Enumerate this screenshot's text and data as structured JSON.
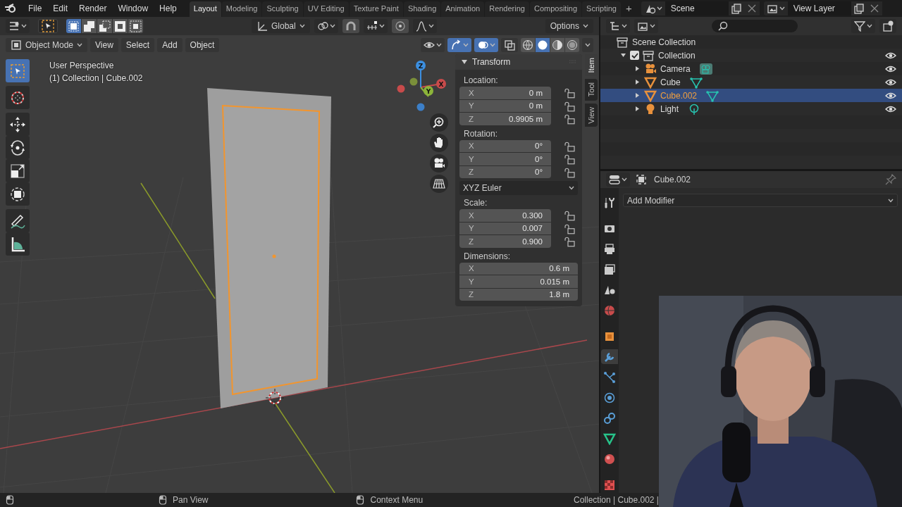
{
  "menu_bar": {
    "menus": [
      "File",
      "Edit",
      "Render",
      "Window",
      "Help"
    ],
    "workspaces": [
      {
        "label": "Layout",
        "selected": true
      },
      {
        "label": "Modeling",
        "selected": false
      },
      {
        "label": "Sculpting",
        "selected": false
      },
      {
        "label": "UV Editing",
        "selected": false
      },
      {
        "label": "Texture Paint",
        "selected": false
      },
      {
        "label": "Shading",
        "selected": false
      },
      {
        "label": "Animation",
        "selected": false
      },
      {
        "label": "Rendering",
        "selected": false
      },
      {
        "label": "Compositing",
        "selected": false
      },
      {
        "label": "Scripting",
        "selected": false
      }
    ],
    "add_workspace": "+",
    "scene": "Scene",
    "view_layer": "View Layer"
  },
  "tool_header": {
    "select_modes": [
      {
        "kind": "new",
        "selected": true
      },
      {
        "kind": "extend",
        "selected": false
      },
      {
        "kind": "subtract",
        "selected": false
      },
      {
        "kind": "difference",
        "selected": false
      },
      {
        "kind": "intersect",
        "selected": false
      }
    ],
    "orientation": "Global",
    "options": "Options"
  },
  "viewport_header": {
    "mode": "Object Mode",
    "menus": [
      "View",
      "Select",
      "Add",
      "Object"
    ],
    "toggles": [
      {
        "kind": "gizmos",
        "on": true
      },
      {
        "kind": "overlays",
        "on": true
      },
      {
        "kind": "xray",
        "on": false
      }
    ],
    "shading": [
      {
        "kind": "wireframe",
        "selected": false
      },
      {
        "kind": "solid",
        "selected": true
      },
      {
        "kind": "material",
        "selected": false
      },
      {
        "kind": "rendered",
        "selected": false
      }
    ]
  },
  "viewport": {
    "overlay_lines": [
      "User Perspective",
      "(1) Collection | Cube.002"
    ],
    "tools": [
      {
        "kind": "select",
        "selected": true
      },
      {
        "kind": "cursor",
        "selected": false
      },
      {
        "kind": "move",
        "selected": false
      },
      {
        "kind": "rotate",
        "selected": false
      },
      {
        "kind": "scale",
        "selected": false
      },
      {
        "kind": "transform",
        "selected": false
      },
      {
        "kind": "annotate",
        "selected": false
      },
      {
        "kind": "measure",
        "selected": false
      }
    ],
    "gizmo_axes": [
      "X",
      "Y",
      "Z"
    ]
  },
  "sidebar": {
    "tabs": [
      {
        "label": "Item",
        "selected": true
      },
      {
        "label": "Tool",
        "selected": false
      },
      {
        "label": "View",
        "selected": false
      }
    ],
    "panel": {
      "title": "Transform",
      "expanded": true,
      "sections": [
        {
          "kind": "vector",
          "label": "Location:",
          "fields": [
            {
              "axis": "X",
              "value": "0 m",
              "locked": false
            },
            {
              "axis": "Y",
              "value": "0 m",
              "locked": false
            },
            {
              "axis": "Z",
              "value": "0.9905 m",
              "locked": false
            }
          ]
        },
        {
          "kind": "vector",
          "label": "Rotation:",
          "fields": [
            {
              "axis": "X",
              "value": "0°",
              "locked": false
            },
            {
              "axis": "Y",
              "value": "0°",
              "locked": false
            },
            {
              "axis": "Z",
              "value": "0°",
              "locked": false
            }
          ]
        },
        {
          "kind": "dropdown",
          "value": "XYZ Euler"
        },
        {
          "kind": "vector",
          "label": "Scale:",
          "fields": [
            {
              "axis": "X",
              "value": "0.300",
              "locked": false
            },
            {
              "axis": "Y",
              "value": "0.007",
              "locked": false
            },
            {
              "axis": "Z",
              "value": "0.900",
              "locked": false
            }
          ]
        },
        {
          "kind": "vector",
          "label": "Dimensions:",
          "fields": [
            {
              "axis": "X",
              "value": "0.6 m"
            },
            {
              "axis": "Y",
              "value": "0.015 m"
            },
            {
              "axis": "Z",
              "value": "1.8 m"
            }
          ]
        }
      ]
    }
  },
  "outliner": {
    "tree": [
      {
        "label": "Scene Collection",
        "kind": "scene",
        "children": [
          {
            "label": "Collection",
            "kind": "collection",
            "checked": true,
            "expanded": true,
            "visible": true,
            "children": [
              {
                "label": "Camera",
                "kind": "camera",
                "expanded": false,
                "selected": false,
                "visible": true
              },
              {
                "label": "Cube",
                "kind": "mesh",
                "expanded": false,
                "selected": false,
                "visible": true
              },
              {
                "label": "Cube.002",
                "kind": "mesh",
                "expanded": false,
                "selected": true,
                "visible": true
              },
              {
                "label": "Light",
                "kind": "light",
                "expanded": false,
                "selected": false,
                "visible": true
              }
            ]
          }
        ]
      }
    ]
  },
  "properties": {
    "object_name": "Cube.002",
    "add_modifier": "Add Modifier",
    "tabs": [
      {
        "kind": "tool",
        "selected": false
      },
      {
        "kind": "render",
        "selected": false
      },
      {
        "kind": "output",
        "selected": false
      },
      {
        "kind": "view_layer",
        "selected": false
      },
      {
        "kind": "scene",
        "selected": false
      },
      {
        "kind": "world",
        "selected": false
      },
      {
        "kind": "object",
        "selected": false
      },
      {
        "kind": "modifiers",
        "selected": true
      },
      {
        "kind": "particles",
        "selected": false
      },
      {
        "kind": "physics",
        "selected": false
      },
      {
        "kind": "constraints",
        "selected": false
      },
      {
        "kind": "data",
        "selected": false
      },
      {
        "kind": "material",
        "selected": false
      },
      {
        "kind": "texture",
        "selected": false
      }
    ]
  },
  "status_bar": {
    "items": [
      {
        "kind": "mouse"
      },
      {
        "kind": "mouse",
        "label": "Pan View"
      },
      {
        "kind": "mouse",
        "label": "Context Menu"
      }
    ],
    "info": "Collection | Cube.002 |"
  }
}
